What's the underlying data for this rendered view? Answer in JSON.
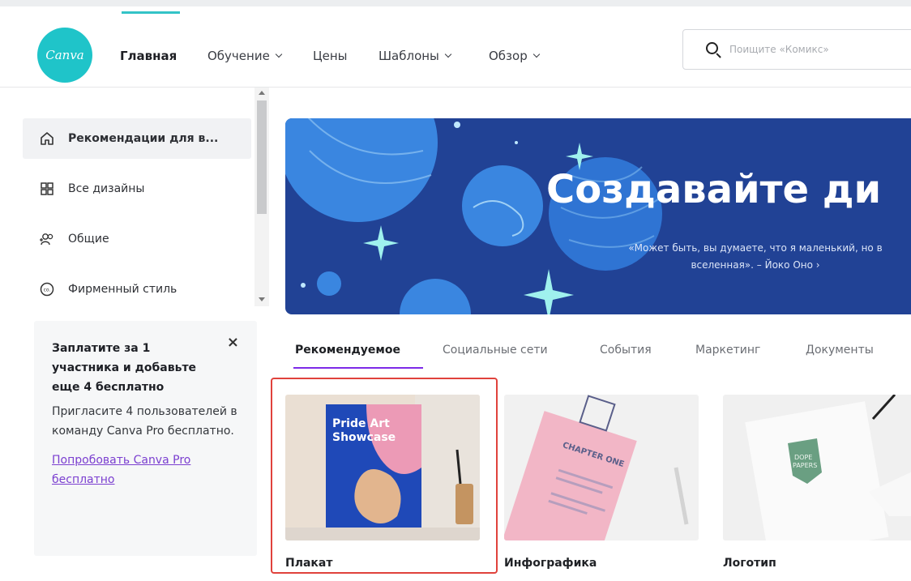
{
  "header": {
    "logo_text": "Canva",
    "nav": [
      {
        "label": "Главная",
        "dropdown": false,
        "active": true
      },
      {
        "label": "Обучение",
        "dropdown": true
      },
      {
        "label": "Цены",
        "dropdown": false
      },
      {
        "label": "Шаблоны",
        "dropdown": true
      },
      {
        "label": "Обзор",
        "dropdown": true
      }
    ],
    "search": {
      "placeholder": "Поищите «Комикс»"
    }
  },
  "sidebar": {
    "items": [
      {
        "label": "Рекомендации для в...",
        "icon": "home-icon",
        "active": true
      },
      {
        "label": "Все дизайны",
        "icon": "grid-icon"
      },
      {
        "label": "Общие",
        "icon": "shared-people-icon"
      },
      {
        "label": "Фирменный стиль",
        "icon": "brand-kit-icon"
      }
    ]
  },
  "promo": {
    "title": "Заплатите за 1 участника и добавьте еще 4 бесплатно",
    "text": "Пригласите 4 пользователей в команду Canva Pro бесплатно.",
    "link": "Попробовать Canva Pro бесплатно",
    "close": "×"
  },
  "banner": {
    "title": "Создавайте ди",
    "quote_line1": "«Может быть, вы думаете, что я маленький, но в",
    "quote_line2": "вселенная». – Йоко Оно ›",
    "bg_color": "#214295"
  },
  "tabs": [
    "Рекомендуемое",
    "Социальные сети",
    "События",
    "Маркетинг",
    "Документы"
  ],
  "cards": [
    {
      "label": "Плакат",
      "poster_title_1": "Pride Art",
      "poster_title_2": "Showcase"
    },
    {
      "label": "Инфографика",
      "book_text": "CHAPTER ONE"
    },
    {
      "label": "Логотип",
      "logo_text": "DOPE\nPAPERS"
    }
  ],
  "colors": {
    "accent": "#7d2ae8",
    "brand": "#1fc4c9",
    "highlight": "#e0423c"
  }
}
